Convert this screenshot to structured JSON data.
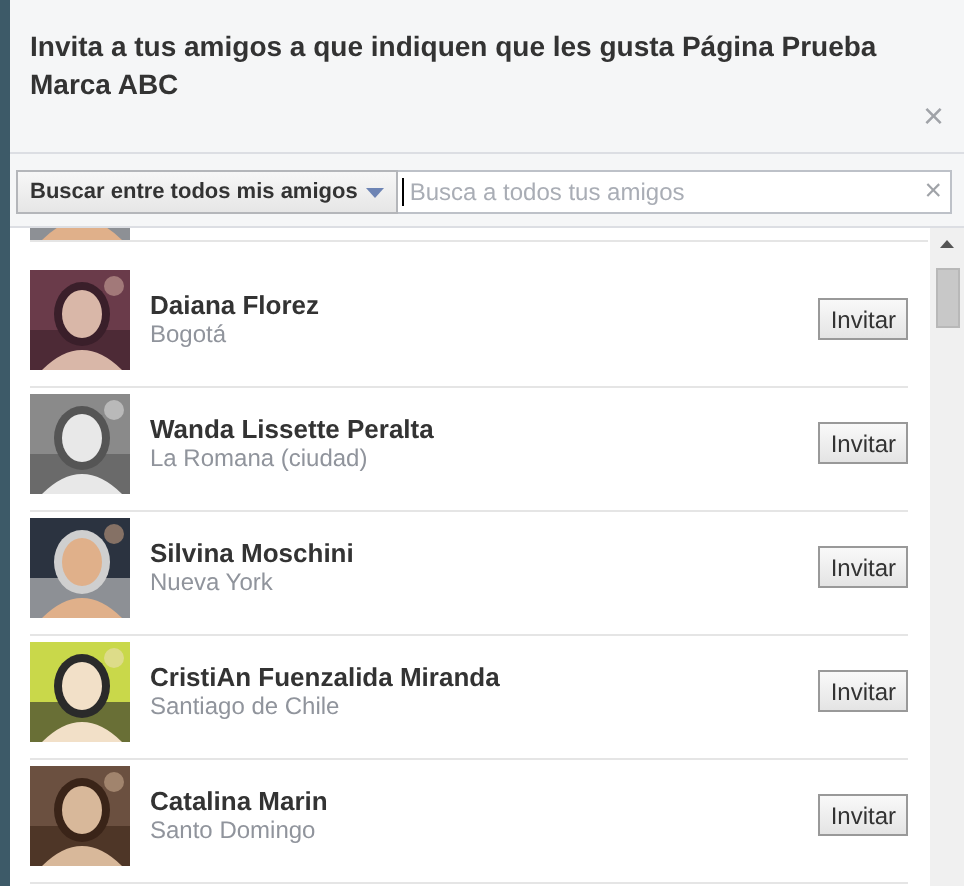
{
  "dialog": {
    "title": "Invita a tus amigos a que indiquen que les gusta Página Prueba Marca ABC",
    "close": "×"
  },
  "filter": {
    "dropdown": "Buscar entre todos mis amigos",
    "search_placeholder": "Busca a todos tus amigos",
    "clear": "×"
  },
  "friends": [
    {
      "name": "Daiana Florez",
      "location": "Bogotá",
      "button": "Invitar"
    },
    {
      "name": "Wanda Lissette Peralta",
      "location": "La Romana (ciudad)",
      "button": "Invitar"
    },
    {
      "name": "Silvina Moschini",
      "location": "Nueva York",
      "button": "Invitar"
    },
    {
      "name": "CristiAn Fuenzalida Miranda",
      "location": "Santiago de Chile",
      "button": "Invitar"
    },
    {
      "name": "Catalina Marin",
      "location": "Santo Domingo",
      "button": "Invitar"
    }
  ]
}
